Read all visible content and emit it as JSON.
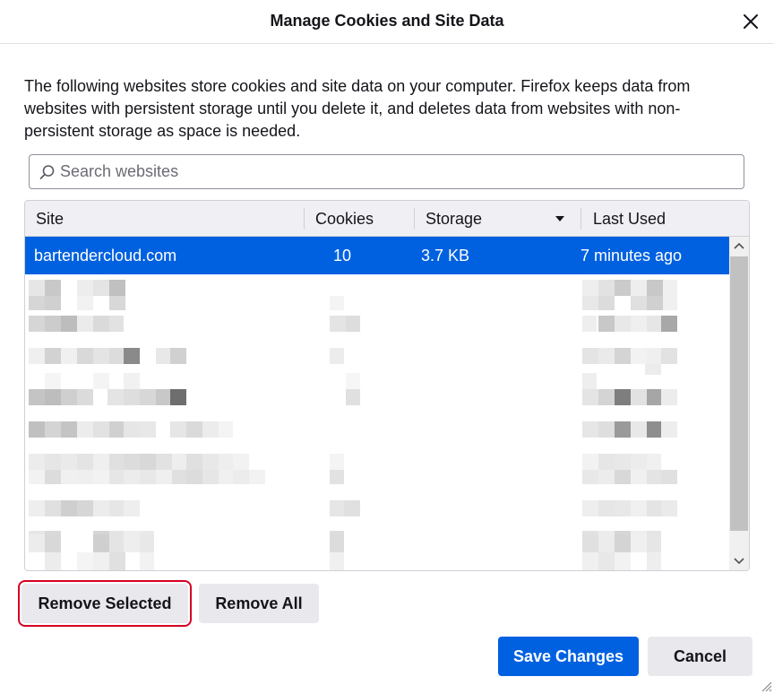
{
  "dialog": {
    "title": "Manage Cookies and Site Data",
    "description": "The following websites store cookies and site data on your computer. Firefox keeps data from websites with persistent storage until you delete it, and deletes data from websites with non-persistent storage as space is needed."
  },
  "search": {
    "placeholder": "Search websites",
    "value": ""
  },
  "table": {
    "columns": [
      "Site",
      "Cookies",
      "Storage",
      "Last Used"
    ],
    "sorted_column": "Storage",
    "sort_direction": "descending",
    "selected_row": {
      "site": "bartendercloud.com",
      "cookies": "10",
      "storage": "3.7 KB",
      "last_used": "7 minutes ago"
    }
  },
  "buttons": {
    "remove_selected": "Remove Selected",
    "remove_all": "Remove All",
    "save_changes": "Save Changes",
    "cancel": "Cancel"
  },
  "colors": {
    "accent": "#0061e0",
    "focus_ring": "#d70022"
  }
}
